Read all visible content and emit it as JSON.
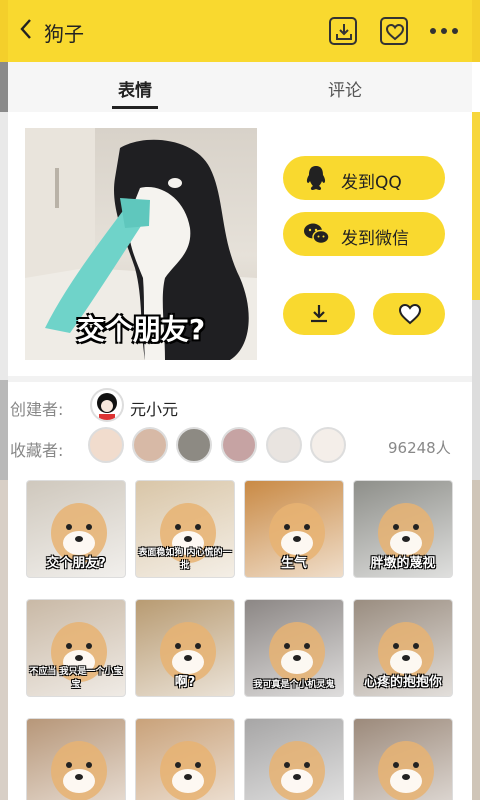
{
  "header": {
    "title": "狗子",
    "back_icon": "chevron-left-icon",
    "download_icon": "download-icon",
    "favorite_icon": "heart-icon",
    "more_icon": "more-horizontal-icon"
  },
  "tabs": [
    {
      "label": "表情",
      "active": true
    },
    {
      "label": "评论",
      "active": false
    }
  ],
  "main_image": {
    "caption": "交个朋友?"
  },
  "actions": {
    "send_qq": "发到QQ",
    "send_wechat": "发到微信",
    "qq_icon": "qq-penguin-icon",
    "wechat_icon": "wechat-icon"
  },
  "creator": {
    "label": "创建者:",
    "name": "元小元"
  },
  "collectors": {
    "label": "收藏者:",
    "count": "96248人"
  },
  "grid": [
    {
      "caption": "交个朋友?",
      "color": "#cfc8bd"
    },
    {
      "caption": "表面稳如狗 内心慌的一批",
      "color": "#d9c6a8"
    },
    {
      "caption": "生气",
      "color": "#c98a45"
    },
    {
      "caption": "胖墩的蔑视",
      "color": "#8e8f8a"
    },
    {
      "caption": "不应当 我只是一个小宝宝",
      "color": "#c9b9a6"
    },
    {
      "caption": "啊?",
      "color": "#b89b72"
    },
    {
      "caption": "我可真是个小机灵鬼",
      "color": "#8c8785"
    },
    {
      "caption": "心疼的抱抱你",
      "color": "#9a8d80"
    },
    {
      "caption": "",
      "color": "#b79779"
    },
    {
      "caption": "",
      "color": "#c9a27a"
    },
    {
      "caption": "",
      "color": "#a7a6a6"
    },
    {
      "caption": "",
      "color": "#9c8a7b"
    }
  ],
  "colors": {
    "accent": "#f9d92f"
  }
}
